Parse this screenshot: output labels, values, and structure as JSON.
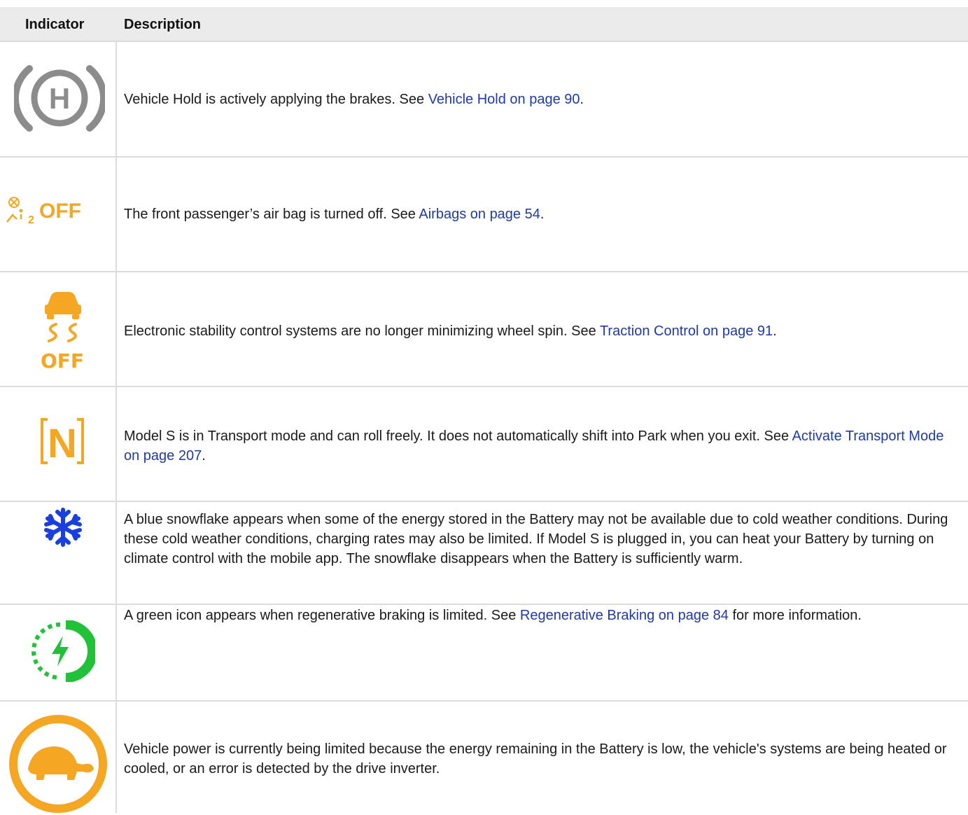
{
  "header": {
    "indicator": "Indicator",
    "description": "Description"
  },
  "rows": [
    {
      "icon": "vehicle-hold-icon",
      "text": "Vehicle Hold is actively applying the brakes. See ",
      "link": "Vehicle Hold on page 90",
      "after": "."
    },
    {
      "icon": "passenger-airbag-off-icon",
      "icon_text": "OFF",
      "icon_sub": "2",
      "text": "The front passenger’s air bag is turned off. See ",
      "link": "Airbags on page 54",
      "after": "."
    },
    {
      "icon": "traction-control-off-icon",
      "icon_text": "OFF",
      "text": "Electronic stability control systems are no longer minimizing wheel spin. See ",
      "link": "Traction Control on page 91",
      "after": "."
    },
    {
      "icon": "transport-mode-icon",
      "icon_text": "N",
      "text": "Model S is in Transport mode and can roll freely. It does not automatically shift into Park when you exit. See ",
      "link": "Activate Transport Mode on page 207",
      "after": "."
    },
    {
      "icon": "snowflake-icon",
      "text": "A blue snowflake appears when some of the energy stored in the Battery may not be available due to cold weather conditions. During these cold weather conditions, charging rates may also be limited. If Model S is plugged in, you can heat your Battery by turning on climate control with the mobile app. The snowflake disappears when the Battery is sufficiently warm.",
      "link": "",
      "after": ""
    },
    {
      "icon": "regen-braking-limited-icon",
      "text": "A green icon appears when regenerative braking is limited. See ",
      "link": "Regenerative Braking on page 84",
      "after": " for more information."
    },
    {
      "icon": "turtle-power-limited-icon",
      "text": "Vehicle power is currently being limited because the energy remaining in the Battery is low, the vehicle's systems are being heated or cooled, or an error is detected by the drive inverter.",
      "link": "",
      "after": ""
    }
  ],
  "colors": {
    "link": "#1f3aa8",
    "gray_icon": "#8c8c8c",
    "amber": "#f5a623",
    "blue": "#1a3fe0",
    "green": "#22c13a"
  }
}
